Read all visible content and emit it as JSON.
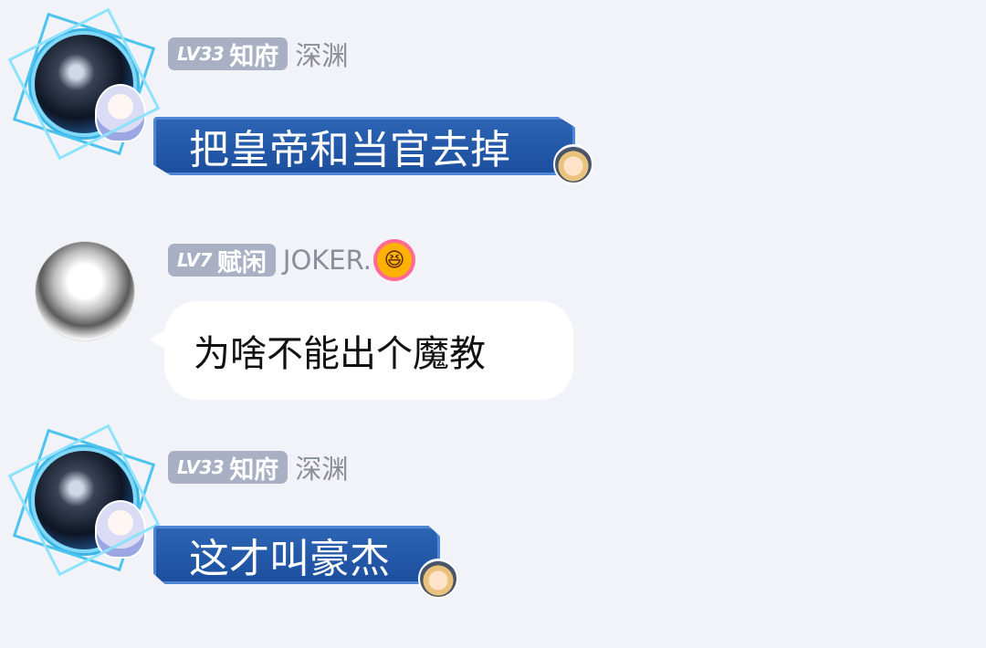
{
  "messages": [
    {
      "level": "LV33",
      "title": "知府",
      "username": "深渊",
      "text": "把皇帝和当官去掉"
    },
    {
      "level": "LV7",
      "title": "赋闲",
      "username": "JOKER.",
      "emoji": "😆",
      "text": "为啥不能出个魔教"
    },
    {
      "level": "LV33",
      "title": "知府",
      "username": "深渊",
      "text": "这才叫豪杰"
    }
  ],
  "colors": {
    "background": "#f2f3f8",
    "badge": "#a9b0c4",
    "bubble_blue": "#1d4f9e",
    "bubble_white": "#ffffff",
    "username": "#8a8e99"
  }
}
